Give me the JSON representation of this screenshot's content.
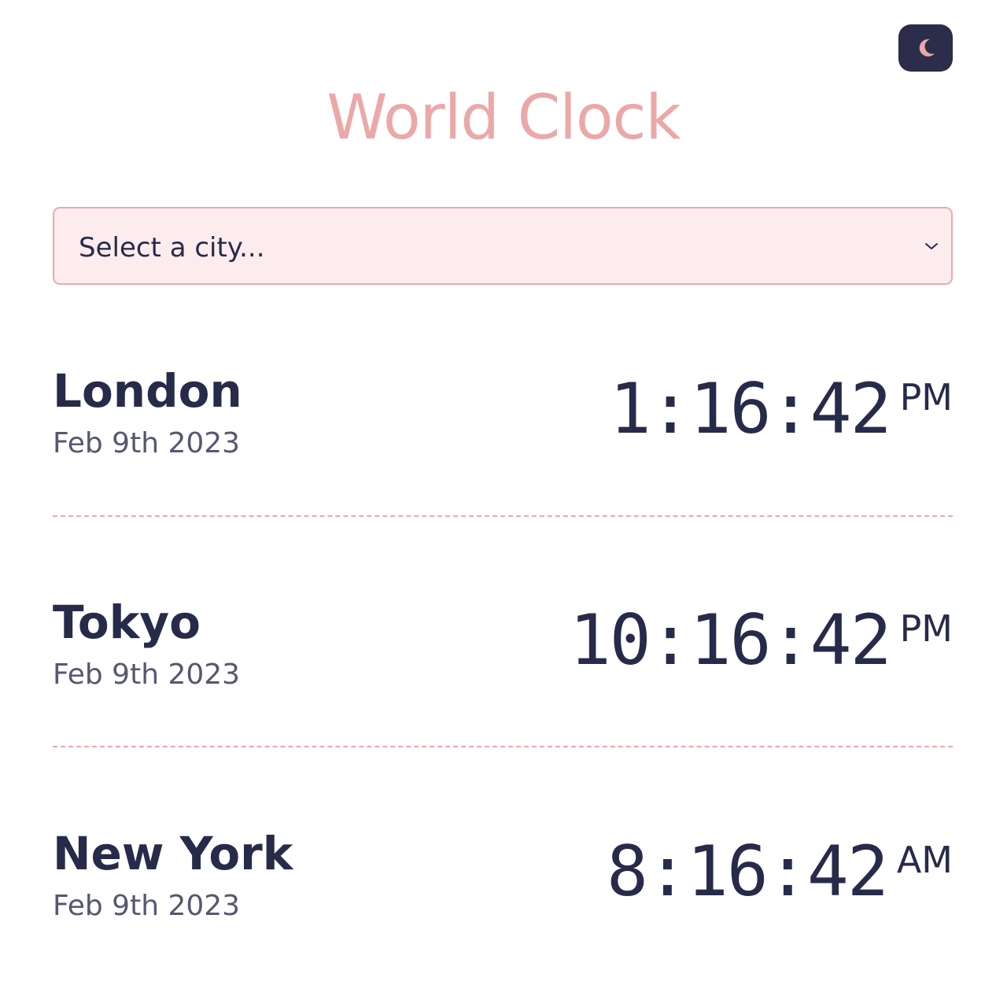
{
  "header": {
    "title": "World Clock",
    "theme_toggle_icon": "moon-icon"
  },
  "city_select": {
    "placeholder": "Select a city...",
    "chevron_icon": "chevron-down-icon"
  },
  "cities": [
    {
      "name": "London",
      "date": "Feb 9th 2023",
      "time": "1:16:42",
      "period": "PM"
    },
    {
      "name": "Tokyo",
      "date": "Feb 9th 2023",
      "time": "10:16:42",
      "period": "PM"
    },
    {
      "name": "New York",
      "date": "Feb 9th 2023",
      "time": "8:16:42",
      "period": "AM"
    }
  ],
  "colors": {
    "accent": "#eba8a8",
    "text": "#272b4a",
    "muted_text": "#55586f",
    "select_background": "#fdeced",
    "toggle_background": "#2b2d4a"
  }
}
